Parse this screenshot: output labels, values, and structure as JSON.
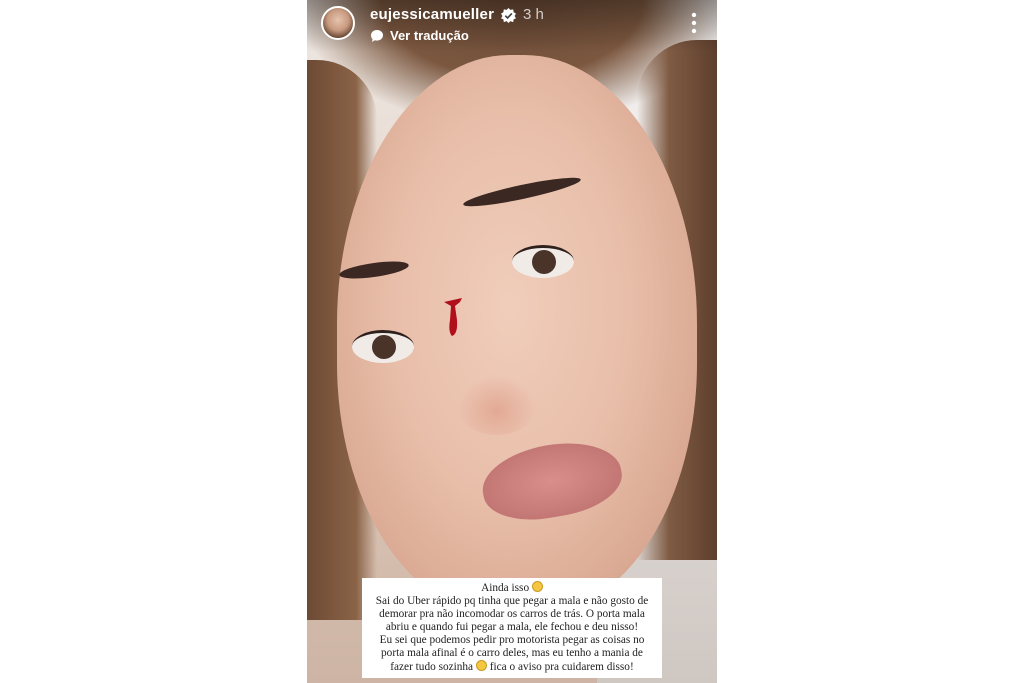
{
  "story": {
    "username": "eujessicamueller",
    "time": "3 h",
    "translate_label": "Ver tradução",
    "caption_lines": [
      "Ainda isso",
      "Sai do Uber rápido pq tinha que pegar a mala e não gosto de",
      "demorar pra não incomodar os carros de trás. O porta mala",
      "abriu e quando fui pegar a mala, ele fechou e deu nisso!",
      "Eu sei que podemos pedir pro motorista pegar as coisas no",
      "porta mala afinal é o carro deles, mas eu tenho a mania de",
      "fazer tudo sozinha",
      "fica o aviso pra cuidarem disso!"
    ]
  },
  "icons": {
    "verified": "verified-badge-icon",
    "translate": "speech-bubble-icon",
    "more": "more-vertical-icon",
    "emoji_sad": "crying-face-emoji",
    "emoji_smile": "smiling-face-emoji"
  },
  "colors": {
    "header_text": "#ffffff",
    "verified_badge": "#ffffff",
    "caption_bg": "#ffffff",
    "caption_text": "#222222"
  }
}
